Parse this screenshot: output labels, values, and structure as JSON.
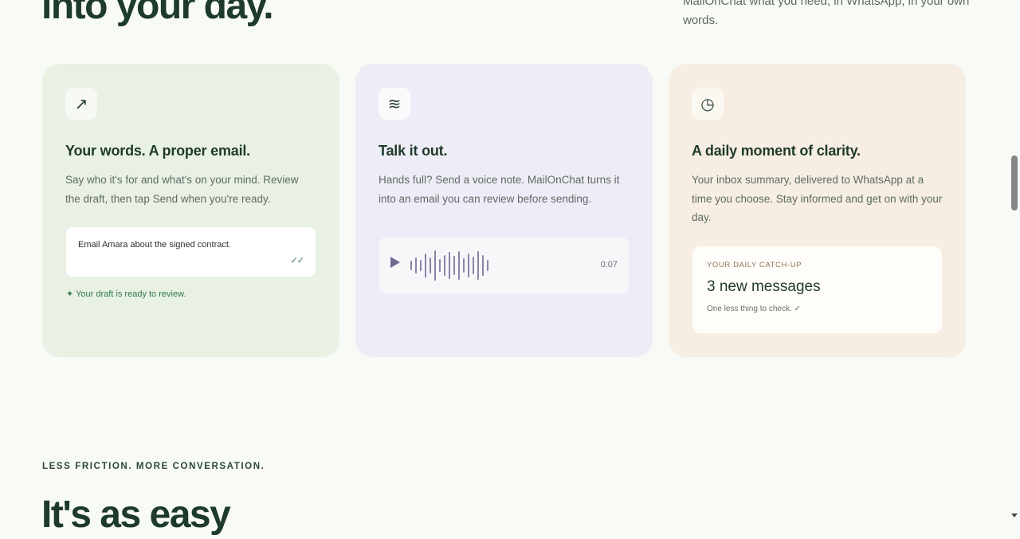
{
  "hero": {
    "heading": "into your day.",
    "subtitle": "MailOnChat what you need, in WhatsApp, in your own words."
  },
  "cards": [
    {
      "icon": "arrow-up-right-icon",
      "icon_glyph": "↗",
      "title": "Your words. A proper email.",
      "description": "Say who it's for and what's on your mind. Review the draft, then tap Send when you're ready.",
      "email_text": "Email Amara about the signed contract.",
      "email_check": "✓✓",
      "status": "✦ Your draft is ready to review."
    },
    {
      "icon": "waves-icon",
      "icon_glyph": "≋",
      "title": "Talk it out.",
      "description": "Hands full? Send a voice note. MailOnChat turns it into an email you can review before sending.",
      "voice_duration": "0:07"
    },
    {
      "icon": "clock-icon",
      "icon_glyph": "◷",
      "title": "A daily moment of clarity.",
      "description": "Your inbox summary, delivered to WhatsApp at a time you choose. Stay informed and get on with your day.",
      "summary_label": "YOUR DAILY CATCH-UP",
      "summary_count": "3 new messages",
      "summary_note": "One less thing to check. ✓"
    }
  ],
  "section": {
    "eyebrow": "LESS FRICTION. MORE CONVERSATION.",
    "heading": "It's as easy"
  },
  "colors": {
    "page_bg": "#f8faf6",
    "card_green": "#e9f1e5",
    "card_purple": "#eeecf6",
    "card_beige": "#f6eee2",
    "heading": "#1d3a2a",
    "accent_green": "#2f7a48"
  }
}
